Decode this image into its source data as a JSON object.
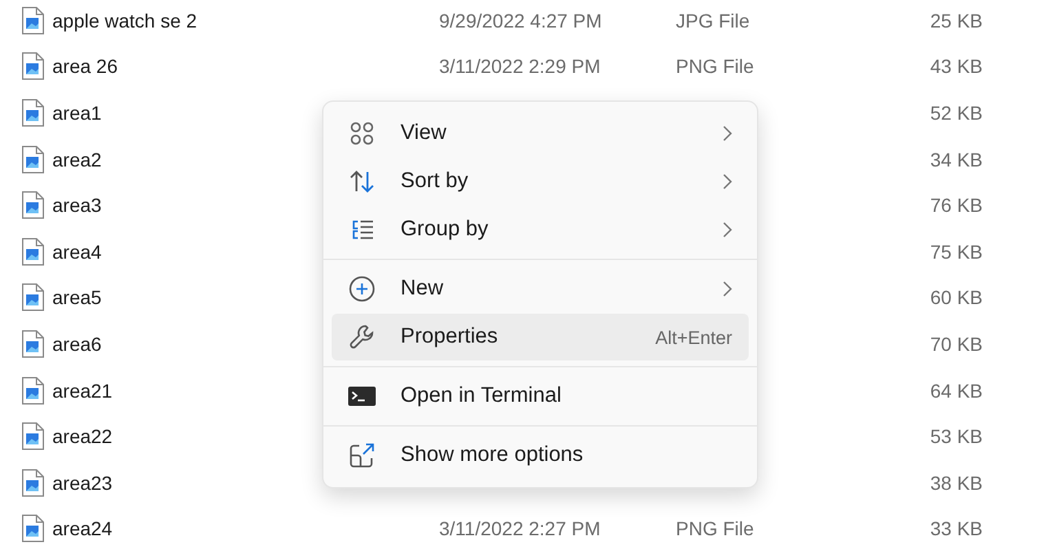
{
  "files": [
    {
      "name": "apple watch se 2",
      "date": "9/29/2022 4:27 PM",
      "type": "JPG File",
      "size": "25 KB"
    },
    {
      "name": "area 26",
      "date": "3/11/2022 2:29 PM",
      "type": "PNG File",
      "size": "43 KB"
    },
    {
      "name": "area1",
      "size": "52 KB"
    },
    {
      "name": "area2",
      "size": "34 KB"
    },
    {
      "name": "area3",
      "size": "76 KB"
    },
    {
      "name": "area4",
      "size": "75 KB"
    },
    {
      "name": "area5",
      "size": "60 KB"
    },
    {
      "name": "area6",
      "size": "70 KB"
    },
    {
      "name": "area21",
      "size": "64 KB"
    },
    {
      "name": "area22",
      "size": "53 KB"
    },
    {
      "name": "area23",
      "size": "38 KB"
    },
    {
      "name": "area24",
      "date": "3/11/2022 2:27 PM",
      "type": "PNG File",
      "size": "33 KB"
    }
  ],
  "context_menu": {
    "sections": [
      {
        "items": [
          {
            "label": "View",
            "has_submenu": true,
            "selected": false
          },
          {
            "label": "Sort by",
            "has_submenu": true,
            "selected": false
          },
          {
            "label": "Group by",
            "has_submenu": true,
            "selected": false
          }
        ]
      },
      {
        "items": [
          {
            "label": "New",
            "has_submenu": true,
            "selected": false
          },
          {
            "label": "Properties",
            "shortcut": "Alt+Enter",
            "has_submenu": false,
            "selected": true
          }
        ]
      },
      {
        "items": [
          {
            "label": "Open in Terminal",
            "has_submenu": false,
            "selected": false
          }
        ]
      },
      {
        "items": [
          {
            "label": "Show more options",
            "has_submenu": false,
            "selected": false
          }
        ]
      }
    ]
  }
}
